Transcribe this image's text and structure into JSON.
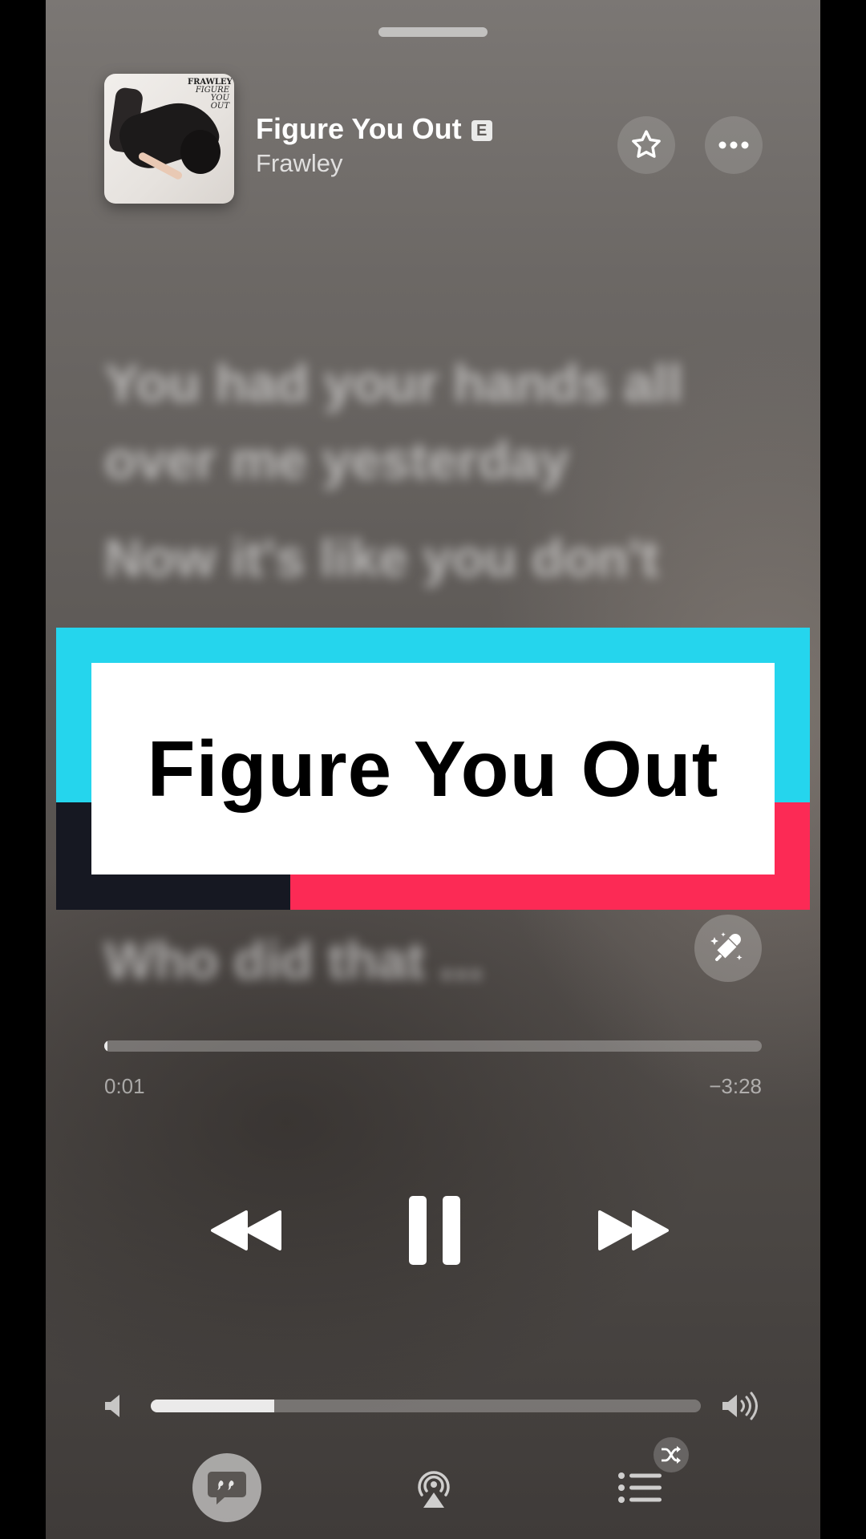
{
  "now_playing": {
    "title": "Figure You Out",
    "explicit_badge": "E",
    "artist": "Frawley",
    "album_art_text": {
      "line1": "FRAWLEY",
      "line2": "FIGURE",
      "line3": "YOU",
      "line4": "OUT"
    }
  },
  "lyrics": {
    "line1": "You had your hands all",
    "line2": "over me yesterday",
    "line3": "Now it's like you don't",
    "line4": "Who did that ..."
  },
  "overlay": {
    "title": "Figure You Out",
    "colors": {
      "cyan": "#25d5ed",
      "dark": "#161822",
      "pink": "#fc2a55",
      "card": "#ffffff"
    }
  },
  "progress": {
    "elapsed": "0:01",
    "remaining": "−3:28",
    "fraction": 0.005
  },
  "volume": {
    "fraction": 0.225
  },
  "icons": {
    "favorite": "star-icon",
    "more": "ellipsis-icon",
    "sing": "mic-sparkle-icon",
    "rewind": "rewind-icon",
    "pause": "pause-icon",
    "forward": "fast-forward-icon",
    "volume_low": "speaker-low-icon",
    "volume_high": "speaker-high-icon",
    "lyrics": "quote-bubble-icon",
    "airplay": "airplay-icon",
    "queue": "list-icon",
    "shuffle": "shuffle-icon"
  }
}
